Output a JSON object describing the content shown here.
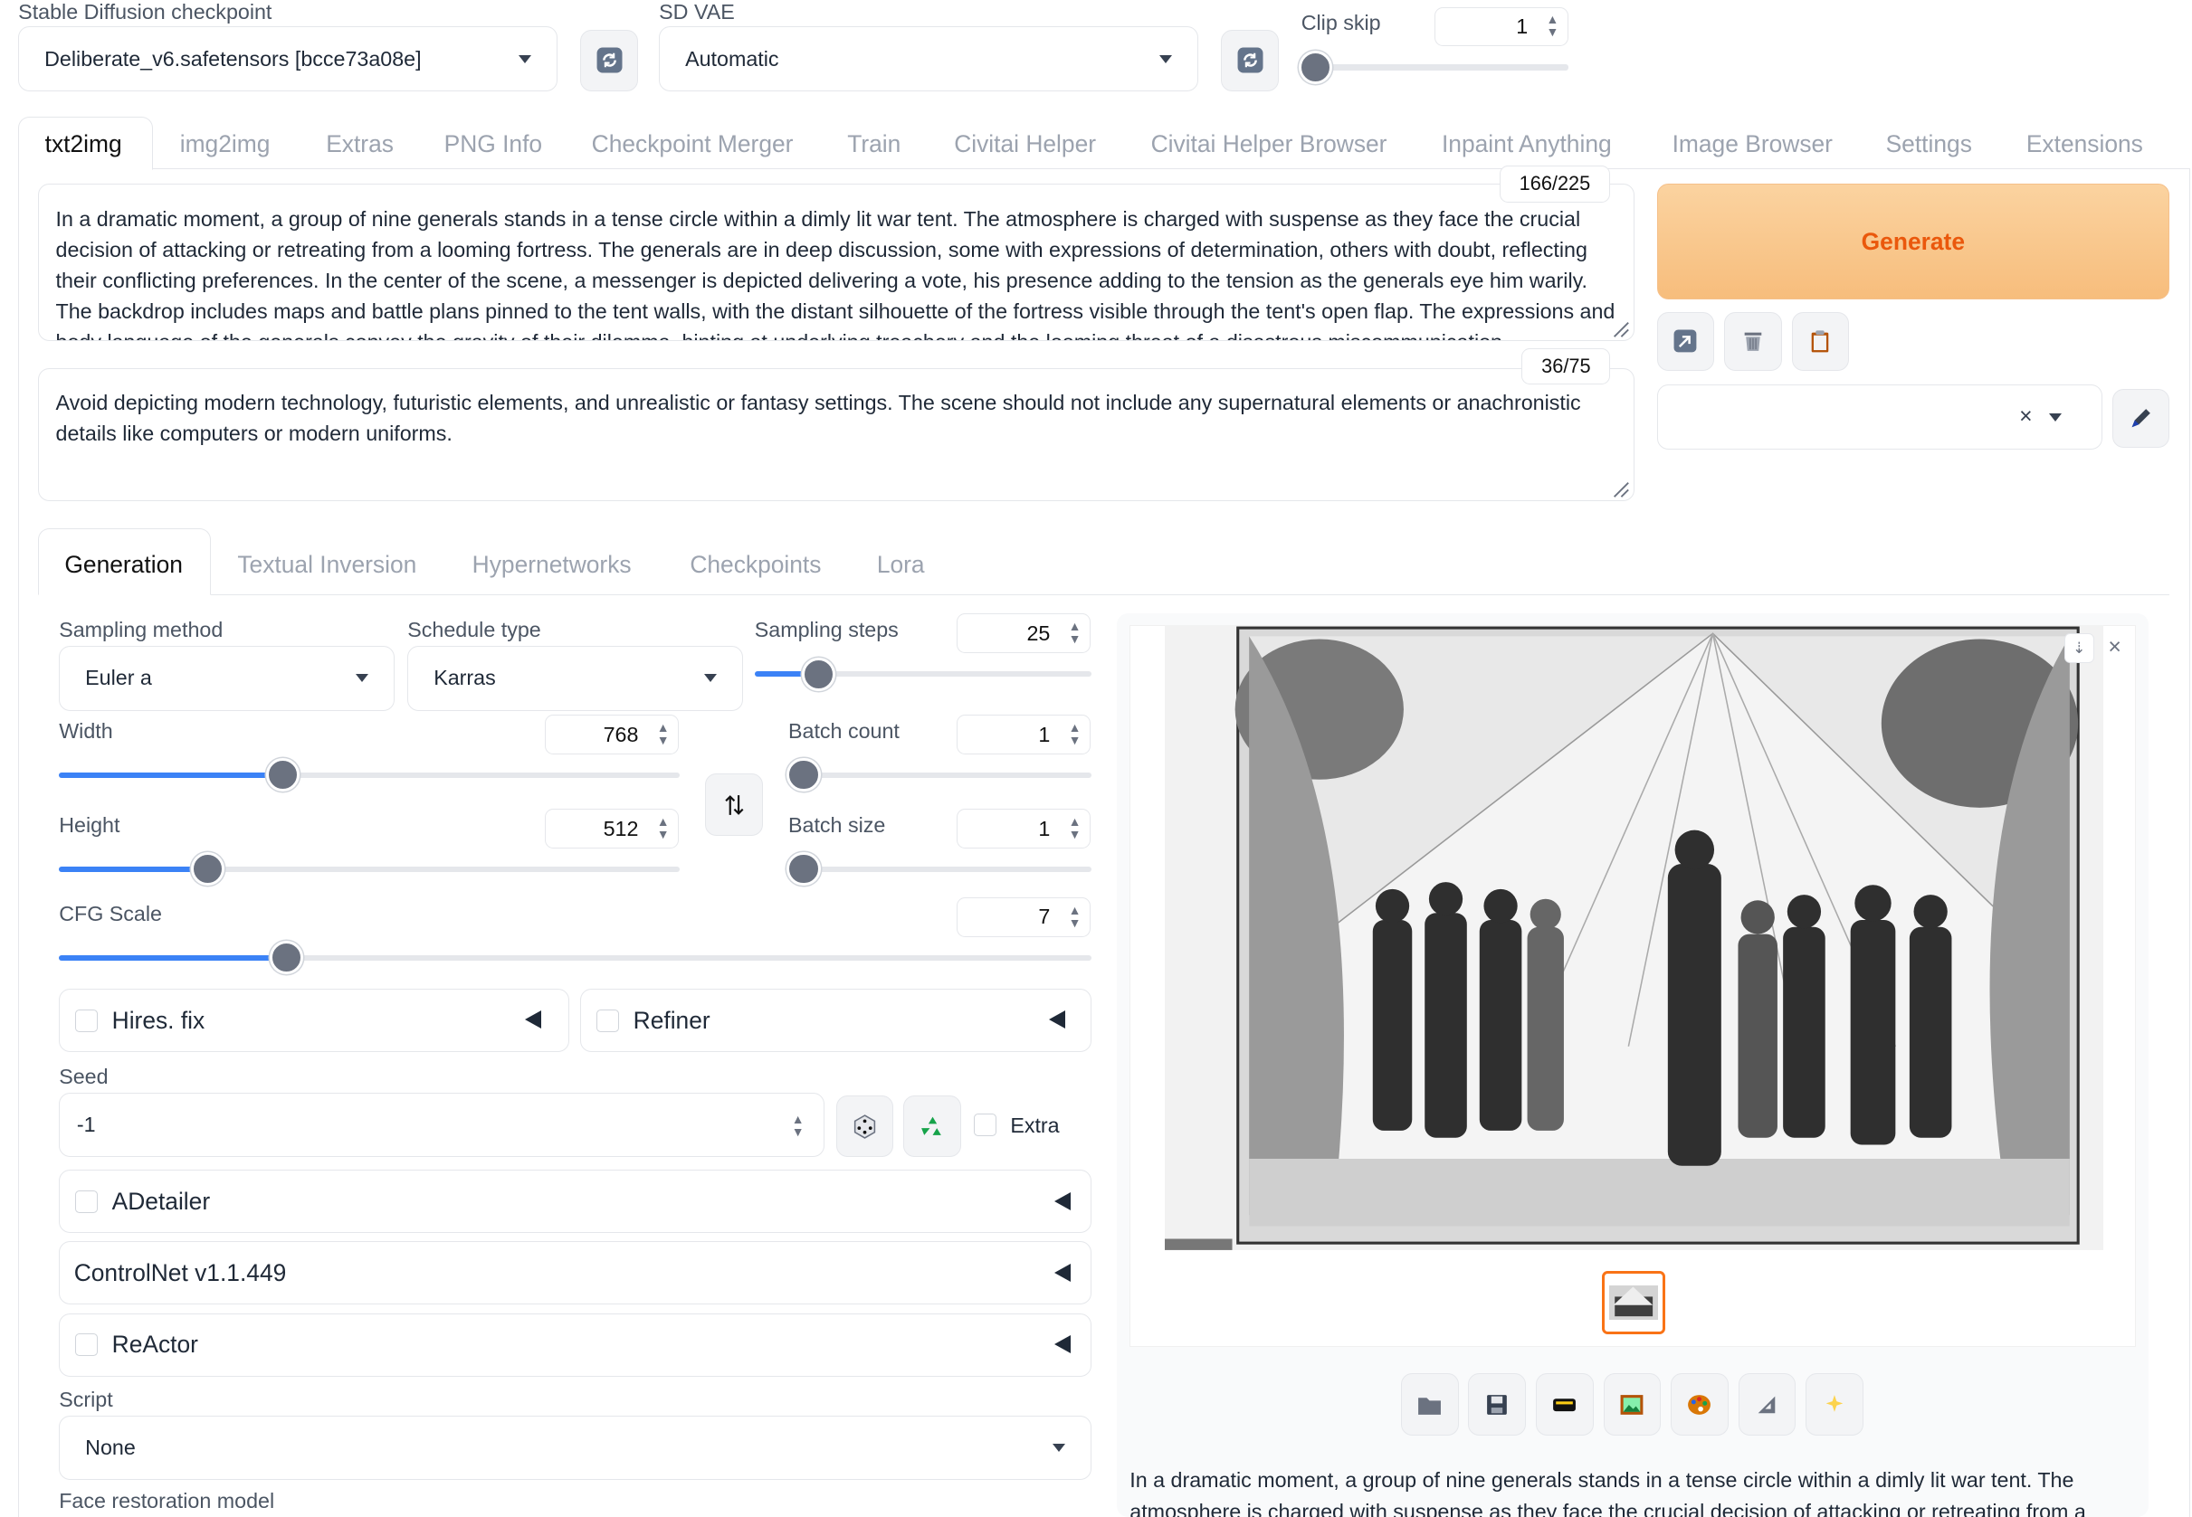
{
  "top": {
    "checkpoint_label": "Stable Diffusion checkpoint",
    "checkpoint_value": "Deliberate_v6.safetensors [bcce73a08e]",
    "vae_label": "SD VAE",
    "vae_value": "Automatic",
    "clip_skip_label": "Clip skip",
    "clip_skip_value": "1"
  },
  "main_tabs": [
    "txt2img",
    "img2img",
    "Extras",
    "PNG Info",
    "Checkpoint Merger",
    "Train",
    "Civitai Helper",
    "Civitai Helper Browser",
    "Inpaint Anything",
    "Image Browser",
    "Settings",
    "Extensions"
  ],
  "prompt": {
    "text": "In a dramatic moment, a group of nine generals stands in a tense circle within a dimly lit war tent. The atmosphere is charged with suspense as they face the crucial decision of attacking or retreating from a looming fortress. The generals are in deep discussion, some with expressions of determination, others with doubt, reflecting their conflicting preferences. In the center of the scene, a messenger is depicted delivering a vote, his presence adding to the tension as the generals eye him warily. The backdrop includes maps and battle plans pinned to the tent walls, with the distant silhouette of the fortress visible through the tent's open flap. The expressions and body language of the generals convey the gravity of their dilemma, hinting at underlying treachery and the looming threat of a disastrous miscommunication.",
    "counter": "166/225"
  },
  "negative_prompt": {
    "text": "Avoid depicting modern technology, futuristic elements, and unrealistic or fantasy settings. The scene should not include any supernatural elements or anachronistic details like computers or modern uniforms.",
    "counter": "36/75"
  },
  "generate_label": "Generate",
  "sub_tabs": [
    "Generation",
    "Textual Inversion",
    "Hypernetworks",
    "Checkpoints",
    "Lora"
  ],
  "params": {
    "sampling_method_label": "Sampling method",
    "sampling_method_value": "Euler a",
    "schedule_type_label": "Schedule type",
    "schedule_type_value": "Karras",
    "sampling_steps_label": "Sampling steps",
    "sampling_steps_value": "25",
    "width_label": "Width",
    "width_value": "768",
    "height_label": "Height",
    "height_value": "512",
    "batch_count_label": "Batch count",
    "batch_count_value": "1",
    "batch_size_label": "Batch size",
    "batch_size_value": "1",
    "cfg_label": "CFG Scale",
    "cfg_value": "7",
    "hires_label": "Hires. fix",
    "refiner_label": "Refiner",
    "seed_label": "Seed",
    "seed_value": "-1",
    "extra_label": "Extra",
    "adetailer_label": "ADetailer",
    "controlnet_label": "ControlNet v1.1.449",
    "reactor_label": "ReActor",
    "script_label": "Script",
    "script_value": "None",
    "face_restoration_label": "Face restoration model"
  },
  "sliders": {
    "clip_skip": 0.0,
    "sampling_steps": 0.19,
    "width": 0.36,
    "height": 0.24,
    "batch_count": 0.0,
    "batch_size": 0.0,
    "cfg_scale": 0.22
  },
  "output_caption": "In a dramatic moment, a group of nine generals stands in a tense circle within a dimly lit war tent. The atmosphere is charged with suspense as they face the crucial decision of attacking or retreating from a looming fortress.",
  "colors": {
    "generate_bg": "#f9c88a",
    "generate_text": "#ea580c",
    "accent": "#3b82f6",
    "thumb_border": "#f97316"
  }
}
